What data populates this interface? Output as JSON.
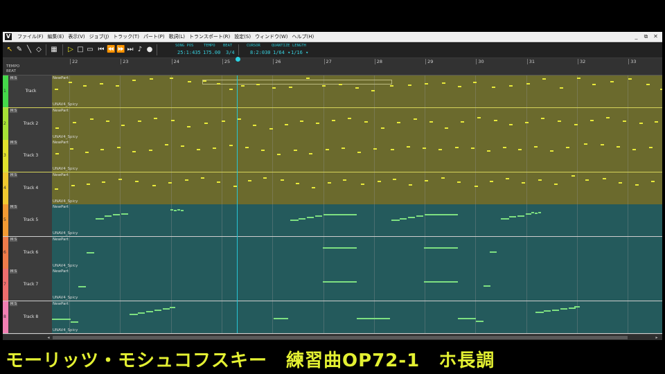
{
  "menu": {
    "logo": "V",
    "items": [
      "ファイル(F)",
      "編集(E)",
      "表示(V)",
      "ジョブ(J)",
      "トラック(T)",
      "パート(P)",
      "歌詞(L)",
      "トランスポート(R)",
      "設定(S)",
      "ウィンドウ(W)",
      "ヘルプ(H)"
    ]
  },
  "window_controls": [
    "_",
    "⧉",
    "✕"
  ],
  "toolbar": {
    "song_pos_label": "SONG POS",
    "song_pos": "25:1:435",
    "tempo_label": "TEMPO",
    "tempo": "175.00",
    "beat_label": "BEAT",
    "beat": "3/4",
    "cursor_label": "CURSOR",
    "cursor": "8:2:030",
    "quantize_label": "QUANTIZE",
    "quantize": "1/64 ▾",
    "length_label": "LENGTH",
    "length": "1/16 ▾"
  },
  "ruler": {
    "tempo_label": "TEMPO",
    "beat_label": "BEAT",
    "measures": [
      "22",
      "23",
      "24",
      "25",
      "26",
      "27",
      "28",
      "29",
      "30",
      "31",
      "32",
      "33"
    ]
  },
  "tracks": [
    {
      "number": "1",
      "name": "Track",
      "part": "NewPart",
      "voice": "UNAV4_Spicy",
      "color": "#45d84a",
      "lane": "olive"
    },
    {
      "number": "2",
      "name": "Track 2",
      "part": "NewPart",
      "voice": "UNAV4_Spicy",
      "color": "#a6e236",
      "lane": "olive"
    },
    {
      "number": "3",
      "name": "Track 3",
      "part": "NewPart",
      "voice": "UNAV4_Spicy",
      "color": "#e0e12d",
      "lane": "olive"
    },
    {
      "number": "4",
      "name": "Track 4",
      "part": "NewPart",
      "voice": "UNAV4_Spicy",
      "color": "#f0c830",
      "lane": "olive"
    },
    {
      "number": "5",
      "name": "Track 5",
      "part": "NewPart",
      "voice": "UNAV4_Spicy",
      "color": "#f29a33",
      "lane": "teal"
    },
    {
      "number": "6",
      "name": "Track 6",
      "part": "NewPart",
      "voice": "UNAV4_Spicy",
      "color": "#ef7b4a",
      "lane": "teal"
    },
    {
      "number": "7",
      "name": "Track 7",
      "part": "NewPart",
      "voice": "UNAV4_Spicy",
      "color": "#ee6e6e",
      "lane": "teal"
    },
    {
      "number": "8",
      "name": "Track 8",
      "part": "NewPart",
      "voice": "UNAV4_Spicy",
      "color": "#f27fb3",
      "lane": "teal"
    }
  ],
  "mute_solo_label": "M S",
  "caption": "モーリッツ・モシュコフスキー　練習曲OP72-1　ホ長調",
  "colors": {
    "playhead": "#27c6d6",
    "note_olive": "#e8ea3a",
    "note_teal": "#7ee081"
  }
}
